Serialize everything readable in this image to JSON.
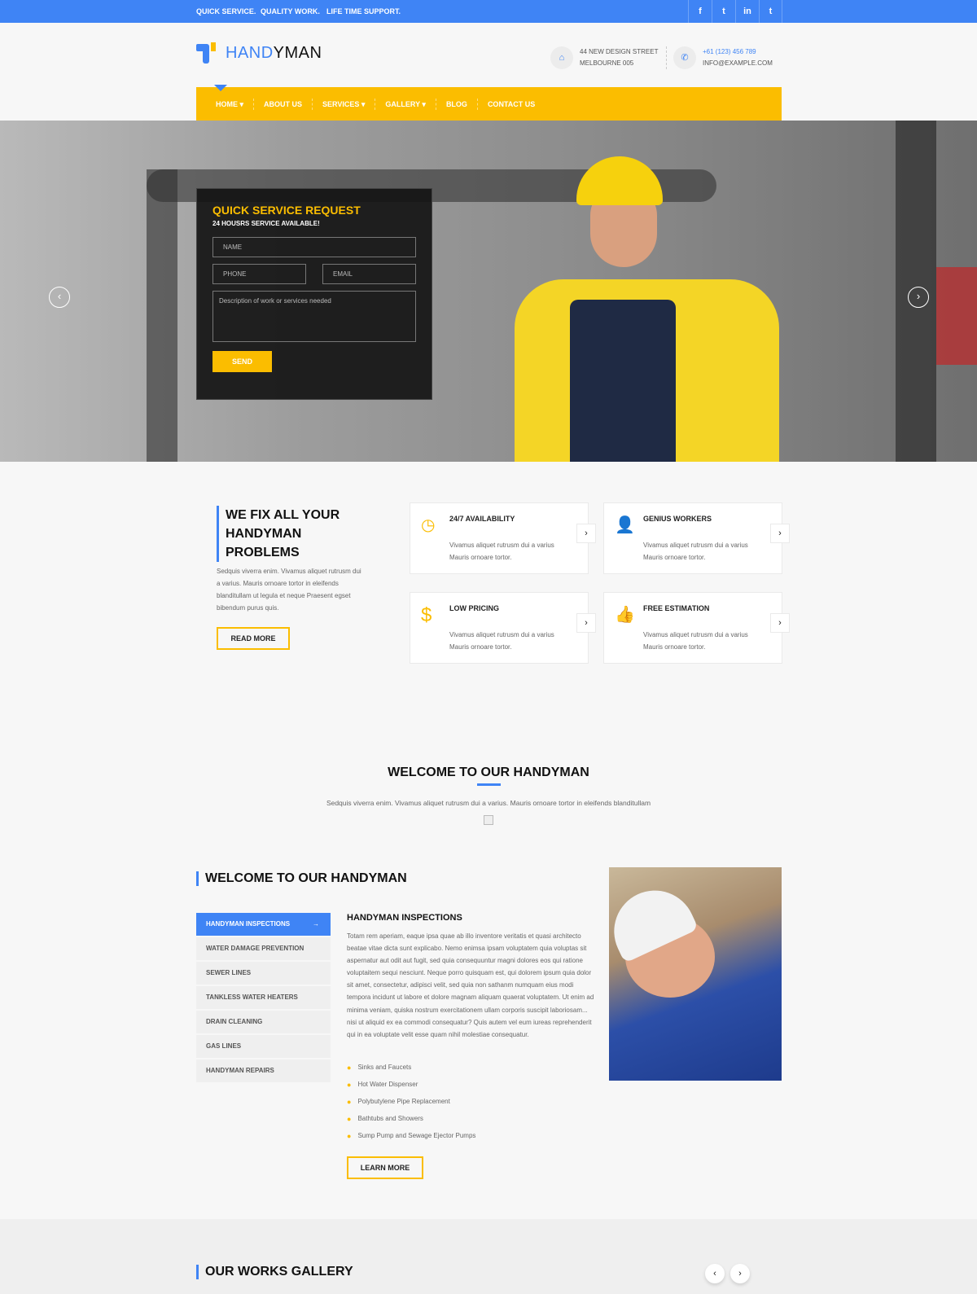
{
  "topbar": {
    "taglines": [
      "QUICK SERVICE.",
      "QUALITY WORK.",
      "LIFE TIME SUPPORT."
    ],
    "social": [
      "f",
      "t",
      "in",
      "t"
    ]
  },
  "brand": {
    "part1": "HAND",
    "part2": "YMAN",
    "blue": "#3f84f5",
    "yellow": "#fbbd00"
  },
  "contact": {
    "address1": "44 NEW DESIGN STREET",
    "address2": "MELBOURNE 005",
    "phone": "+61 (123) 456 789",
    "email": "INFO@EXAMPLE.COM"
  },
  "nav": [
    "HOME ▾",
    "ABOUT US",
    "SERVICES ▾",
    "GALLERY ▾",
    "BLOG",
    "CONTACT US"
  ],
  "hero": {
    "form_title": "QUICK SERVICE REQUEST",
    "form_subtitle": "24 HOUSRS SERVICE AVAILABLE!",
    "name_ph": "NAME",
    "phone_ph": "PHONE",
    "email_ph": "EMAIL",
    "desc_ph": "Description of work or services needed",
    "send": "SEND",
    "prev": "‹",
    "next": "›"
  },
  "intro": {
    "title_lines": [
      "WE FIX ALL YOUR",
      "HANDYMAN",
      "PROBLEMS"
    ],
    "text": "Sedquis viverra enim. Vivamus aliquet rutrusm dui a varius. Mauris ornoare tortor in eleifends blanditullam ut legula et neque Praesent egset bibendum purus quis.",
    "button": "READ MORE"
  },
  "features": [
    {
      "icon": "clock-icon",
      "glyph": "◷",
      "title": "24/7 AVAILABILITY",
      "text": "Vivamus aliquet rutrusm dui a varius Mauris ornoare tortor."
    },
    {
      "icon": "user-icon",
      "glyph": "👤",
      "title": "GENIUS WORKERS",
      "text": "Vivamus aliquet rutrusm dui a varius Mauris ornoare tortor."
    },
    {
      "icon": "dollar-icon",
      "glyph": "$",
      "title": "LOW PRICING",
      "text": "Vivamus aliquet rutrusm dui a varius Mauris ornoare tortor."
    },
    {
      "icon": "thumbs-up-icon",
      "glyph": "👍",
      "title": "FREE ESTIMATION",
      "text": "Vivamus aliquet rutrusm dui a varius Mauris ornoare tortor."
    }
  ],
  "welcome": {
    "title": "WELCOME TO OUR HANDYMAN",
    "text": "Sedquis viverra enim. Vivamus aliquet rutrusm dui a varius. Mauris ornoare tortor in eleifends blanditullam"
  },
  "services": {
    "title": "WELCOME TO OUR HANDYMAN",
    "tabs": [
      "HANDYMAN INSPECTIONS",
      "WATER DAMAGE PREVENTION",
      "SEWER LINES",
      "TANKLESS WATER HEATERS",
      "DRAIN CLEANING",
      "GAS LINES",
      "HANDYMAN REPAIRS"
    ],
    "active_title": "HANDYMAN INSPECTIONS",
    "text": "Totam rem aperiam, eaque ipsa quae ab illo inventore veritatis et quasi architecto beatae vitae dicta sunt explicabo. Nemo enimsa ipsam voluptatem quia voluptas sit aspernatur aut odit aut fugit, sed quia consequuntur magni dolores eos qui ratione voluptaitem sequi nesciunt. Neque porro quisquam est, qui dolorem ipsum quia dolor sit amet, consectetur, adipisci velit, sed quia non sathanm numquam eius modi tempora incidunt ut labore et dolore magnam aliquam quaerat voluptatem. Ut enim ad minima veniam, quiska nostrum exercitationem ullam corporis suscipit laboriosam... nisi ut aliquid ex ea commodi consequatur? Quis autem vel eum iureas reprehenderit qui in ea voluptate velit esse quam nihil molestiae consequatur.",
    "list": [
      "Sinks and Faucets",
      "Hot Water Dispenser",
      "Polybutylene Pipe Replacement",
      "Bathtubs and Showers",
      "Sump Pump and Sewage Ejector Pumps"
    ],
    "button": "LEARN MORE"
  },
  "gallery": {
    "title": "OUR WORKS GALLERY",
    "prev": "‹",
    "next": "›"
  }
}
